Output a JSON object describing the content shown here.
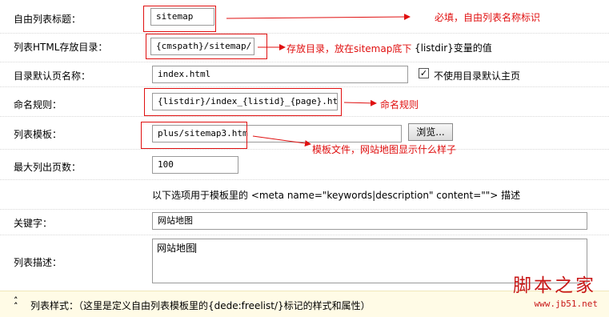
{
  "fields": {
    "list_title": {
      "label": "自由列表标题：",
      "value": "sitemap"
    },
    "html_dir": {
      "label": "列表HTML存放目录：",
      "value": "{cmspath}/sitemap/",
      "suffix": "{listdir}变量的值"
    },
    "default_page": {
      "label": "目录默认页名称：",
      "value": "index.html",
      "checkbox_label": "不使用目录默认主页",
      "checkbox_checked": true
    },
    "naming_rule": {
      "label": "命名规则：",
      "value": "{listdir}/index_{listid}_{page}.html"
    },
    "list_template": {
      "label": "列表模板：",
      "value": "plus/sitemap3.htm",
      "browse_label": "浏览..."
    },
    "max_pages": {
      "label": "最大列出页数：",
      "value": "100"
    },
    "template_note": "以下选项用于模板里的 <meta name=\"keywords|description\" content=\"\"> 描述",
    "keywords": {
      "label": "关键字：",
      "value": "网站地图"
    },
    "description": {
      "label": "列表描述：",
      "value": "网站地图"
    }
  },
  "annotations": {
    "required": "必填，自由列表名称标识",
    "storage": "存放目录，放在sitemap底下",
    "naming": "命名规则",
    "template": "模板文件，网站地图显示什么样子"
  },
  "footer": {
    "icon": "double-chevron-up-icon",
    "text": "列表样式：（这里是定义自由列表模板里的{dede:freelist/}标记的样式和属性）"
  },
  "watermark": {
    "site": "脚本之家",
    "url": "www.jb51.net"
  },
  "colors": {
    "annotation_red": "#e01010",
    "footer_bg": "#fffbe6"
  }
}
